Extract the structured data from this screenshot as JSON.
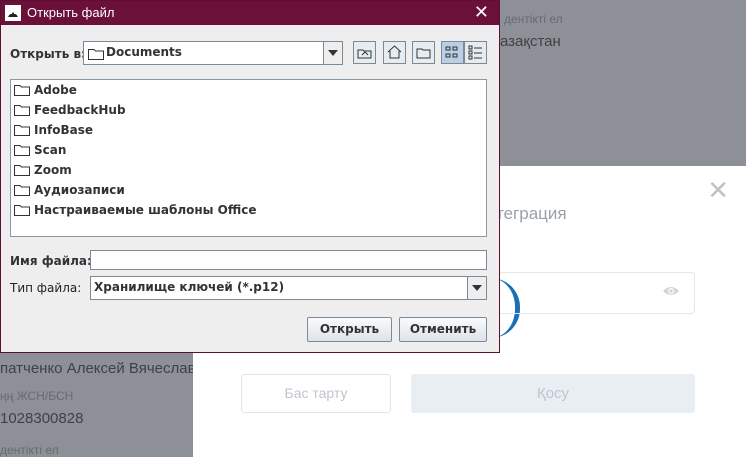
{
  "background": {
    "top_right_label": "дентікті ел",
    "top_right_value": "азақстан",
    "person_name": "патченко Алексей Вячеслав",
    "iin_label": "ңң ЖСН/БСН",
    "iin_value": "1028300828",
    "bottom_label": "дентікті ел"
  },
  "modal": {
    "title": "теграция",
    "close_icon": "close-icon",
    "cancel_label": "Бас тарту",
    "add_label": "Қосу"
  },
  "dialog": {
    "title": "Открыть файл",
    "look_in_label": "Открыть в:",
    "look_in_value": "Documents",
    "files": [
      "Adobe",
      "FeedbackHub",
      "InfoBase",
      "Scan",
      "Zoom",
      "Аудиозаписи",
      "Настраиваемые шаблоны Office"
    ],
    "file_name_label": "Имя файла:",
    "file_name_value": "",
    "file_type_label": "Тип файла:",
    "file_type_value": "Хранилище ключей (*.p12)",
    "open_label": "Открыть",
    "cancel_label": "Отменить"
  },
  "colors": {
    "titlebar": "#6a1039",
    "accent": "#1a6fb5"
  }
}
